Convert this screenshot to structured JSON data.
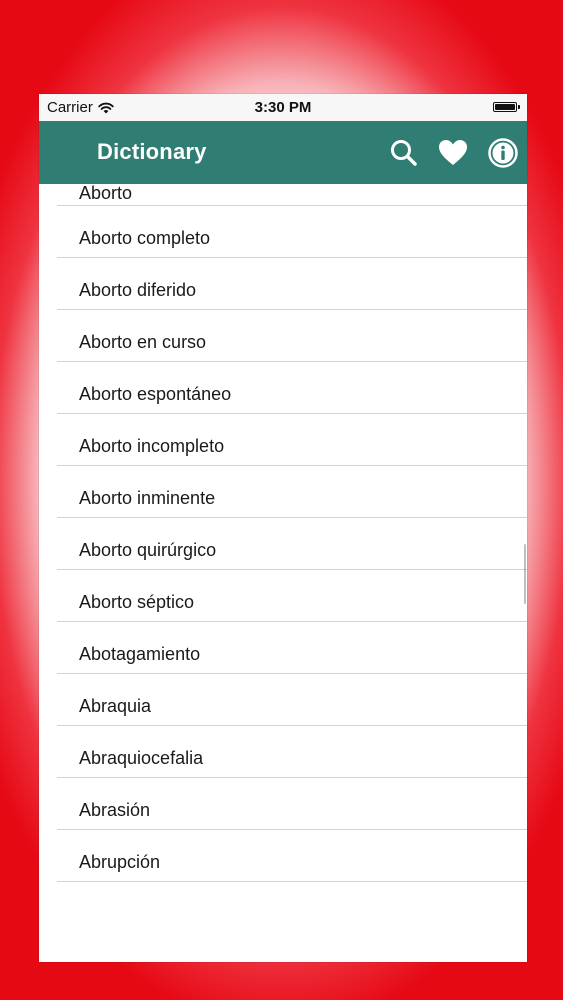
{
  "status_bar": {
    "carrier": "Carrier",
    "time": "3:30 PM"
  },
  "nav_bar": {
    "title": "Dictionary",
    "icons": [
      "search-icon",
      "heart-icon",
      "info-icon"
    ],
    "color": "#2f7d73"
  },
  "list": {
    "items": [
      "Aborto",
      "Aborto completo",
      "Aborto diferido",
      "Aborto en curso",
      "Aborto espontáneo",
      "Aborto incompleto",
      "Aborto inminente",
      "Aborto quirúrgico",
      "Aborto séptico",
      "Abotagamiento",
      "Abraquia",
      "Abraquiocefalia",
      "Abrasión",
      "Abrupción"
    ]
  },
  "background": {
    "accent": "#e50914"
  }
}
